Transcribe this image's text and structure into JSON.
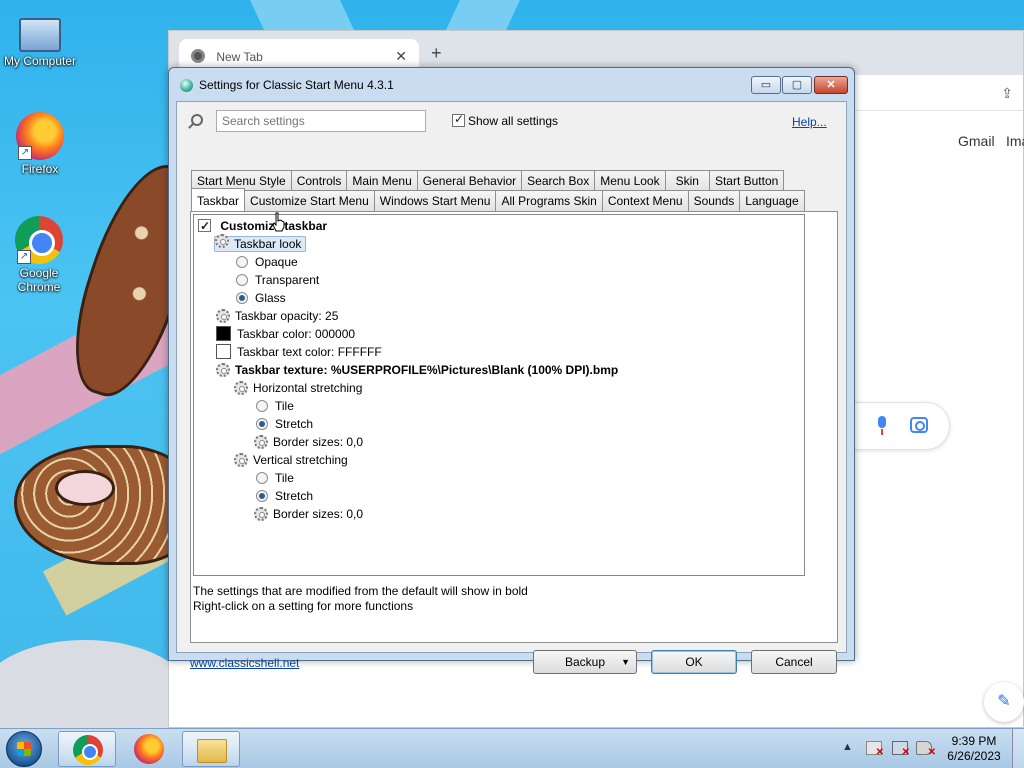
{
  "desktop": {
    "icons": [
      {
        "label": "My Computer",
        "icon": "computer-icon"
      },
      {
        "label": "Firefox",
        "icon": "firefox-icon"
      },
      {
        "label": "Google Chrome",
        "icon": "chrome-icon"
      }
    ]
  },
  "browser": {
    "tab_title": "New Tab",
    "tab_close": "✕",
    "new_tab": "+",
    "gmail": "Gmail",
    "images": "Ima",
    "share_icon": "⇪"
  },
  "dialog": {
    "title": "Settings for Classic Start Menu 4.3.1",
    "controls": {
      "minimize": "▭",
      "maximize": "▢",
      "close": "✕"
    },
    "search_placeholder": "Search settings",
    "show_all_label": "Show all settings",
    "show_all_checked": true,
    "help_link": "Help...",
    "tabs_row1": [
      "Start Menu Style",
      "Controls",
      "Main Menu",
      "General Behavior",
      "Search Box",
      "Menu Look",
      "Skin",
      "Start Button"
    ],
    "tabs_row2": [
      "Taskbar",
      "Customize Start Menu",
      "Windows Start Menu",
      "All Programs Skin",
      "Context Menu",
      "Sounds",
      "Language"
    ],
    "active_tab": "Taskbar",
    "tree": {
      "customize_taskbar": "Customize taskbar",
      "taskbar_look": "Taskbar look",
      "look_options": [
        "Opaque",
        "Transparent",
        "Glass"
      ],
      "look_selected": "Glass",
      "opacity": "Taskbar opacity: 25",
      "color": "Taskbar color: 000000",
      "text_color": "Taskbar text color: FFFFFF",
      "texture": "Taskbar texture: %USERPROFILE%\\Pictures\\Blank (100% DPI).bmp",
      "horizontal": "Horizontal stretching",
      "vertical": "Vertical stretching",
      "tile": "Tile",
      "stretch": "Stretch",
      "border_sizes": "Border sizes: 0,0"
    },
    "note1": "The settings that are modified from the default will show in bold",
    "note2": "Right-click on a setting for more functions",
    "website": "www.classicshell.net",
    "backup": "Backup",
    "ok": "OK",
    "cancel": "Cancel",
    "colors": {
      "taskbar_color": "#000000",
      "text_color": "#FFFFFF"
    }
  },
  "taskbar": {
    "time": "9:39 PM",
    "date": "6/26/2023",
    "tray_arrow": "▲"
  }
}
